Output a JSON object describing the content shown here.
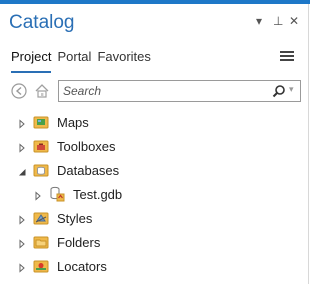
{
  "pane": {
    "title": "Catalog",
    "menu_glyph": "▾",
    "pin_glyph": "⊥",
    "close_glyph": "✕"
  },
  "tabs": [
    {
      "label": "Project",
      "active": true
    },
    {
      "label": "Portal",
      "active": false
    },
    {
      "label": "Favorites",
      "active": false
    }
  ],
  "search": {
    "placeholder": "Search",
    "value": ""
  },
  "tree": [
    {
      "label": "Maps",
      "icon": "maps-folder-icon",
      "expanded": false
    },
    {
      "label": "Toolboxes",
      "icon": "toolboxes-folder-icon",
      "expanded": false
    },
    {
      "label": "Databases",
      "icon": "databases-folder-icon",
      "expanded": true
    },
    {
      "label": "Test.gdb",
      "icon": "geodatabase-icon",
      "expanded": false
    },
    {
      "label": "Styles",
      "icon": "styles-folder-icon",
      "expanded": false
    },
    {
      "label": "Folders",
      "icon": "folders-folder-icon",
      "expanded": false
    },
    {
      "label": "Locators",
      "icon": "locators-folder-icon",
      "expanded": false
    }
  ],
  "colors": {
    "accent": "#1e78c8",
    "title": "#2a6fb5",
    "folder": "#f0b94a"
  }
}
